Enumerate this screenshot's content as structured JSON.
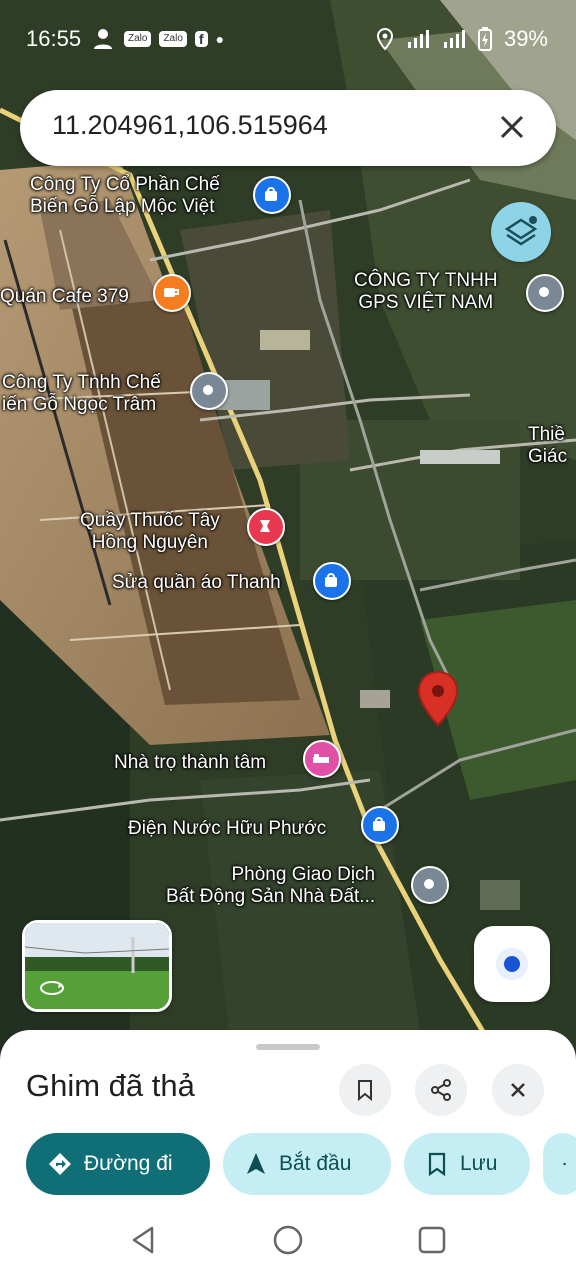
{
  "status_bar": {
    "time": "16:55",
    "notif_zalo_1": "Zalo",
    "notif_zalo_2": "Zalo",
    "notif_fb": "f",
    "battery": "39%"
  },
  "search": {
    "query": "11.204961,106.515964"
  },
  "map": {
    "labels": {
      "go_lap_moc_l1": "Công Ty Cổ Phần Chế",
      "go_lap_moc_l2": "Biến Gỗ Lập Mộc Việt",
      "cafe": "Quán Cafe 379",
      "gps_l1": "CÔNG TY TNHH",
      "gps_l2": "GPS VIỆT NAM",
      "ngoc_tram_l1": "Công Ty Tnhh Chế",
      "ngoc_tram_l2": "iến Gỗ Ngọc Trâm",
      "thien_l1": "Thiề",
      "thien_l2": "Giác",
      "quay_thuoc_l1": "Quầy Thuốc Tây",
      "quay_thuoc_l2": "Hồng Nguyên",
      "sua_quan_ao": "Sửa quần áo Thanh",
      "nha_tro": "Nhà trọ thành tâm",
      "dien_nuoc": "Điện Nước Hữu Phước",
      "giao_dich_l1": "Phòng Giao Dịch",
      "giao_dich_l2": "Bất Động Sản Nhà Đất..."
    },
    "colors": {
      "pin_red": "#d93025",
      "shop_blue": "#1a73e8",
      "food_orange": "#f57c1f",
      "pharmacy_red": "#e8384f",
      "lodging_pink": "#e14fa6",
      "generic_gray": "#7a8794",
      "road_yellow": "#e9d27a"
    }
  },
  "sheet": {
    "title": "Ghim đã thả",
    "chips": {
      "directions": "Đường đi",
      "start": "Bắt đầu",
      "save": "Lưu"
    }
  }
}
